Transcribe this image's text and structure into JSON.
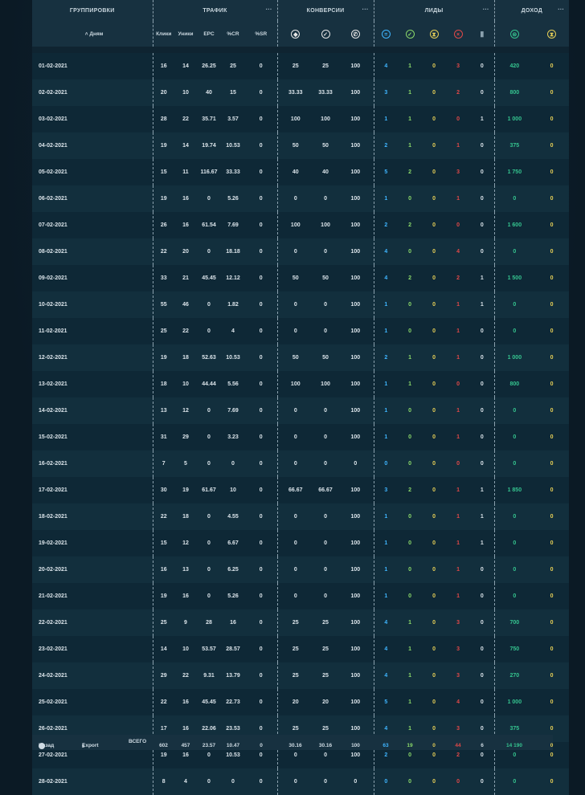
{
  "headers": {
    "grouping": "ГРУППИРОВКИ",
    "traffic": "ТРАФИК",
    "conversions": "КОНВЕРСИИ",
    "leads": "ЛИДЫ",
    "income": "ДОХОД",
    "more": "···",
    "sort_label": "˄ Дням",
    "traffic_cols": [
      "Клики",
      "Уники",
      "EPC",
      "%CR",
      "%SR"
    ]
  },
  "rows": [
    [
      "01-02-2021",
      "16",
      "14",
      "26.25",
      "25",
      "0",
      "25",
      "25",
      "100",
      "4",
      "1",
      "0",
      "3",
      "0",
      "420",
      "0"
    ],
    [
      "02-02-2021",
      "20",
      "10",
      "40",
      "15",
      "0",
      "33.33",
      "33.33",
      "100",
      "3",
      "1",
      "0",
      "2",
      "0",
      "800",
      "0"
    ],
    [
      "03-02-2021",
      "28",
      "22",
      "35.71",
      "3.57",
      "0",
      "100",
      "100",
      "100",
      "1",
      "1",
      "0",
      "0",
      "1",
      "1 000",
      "0"
    ],
    [
      "04-02-2021",
      "19",
      "14",
      "19.74",
      "10.53",
      "0",
      "50",
      "50",
      "100",
      "2",
      "1",
      "0",
      "1",
      "0",
      "375",
      "0"
    ],
    [
      "05-02-2021",
      "15",
      "11",
      "116.67",
      "33.33",
      "0",
      "40",
      "40",
      "100",
      "5",
      "2",
      "0",
      "3",
      "0",
      "1 750",
      "0"
    ],
    [
      "06-02-2021",
      "19",
      "16",
      "0",
      "5.26",
      "0",
      "0",
      "0",
      "100",
      "1",
      "0",
      "0",
      "1",
      "0",
      "0",
      "0"
    ],
    [
      "07-02-2021",
      "26",
      "16",
      "61.54",
      "7.69",
      "0",
      "100",
      "100",
      "100",
      "2",
      "2",
      "0",
      "0",
      "0",
      "1 600",
      "0"
    ],
    [
      "08-02-2021",
      "22",
      "20",
      "0",
      "18.18",
      "0",
      "0",
      "0",
      "100",
      "4",
      "0",
      "0",
      "4",
      "0",
      "0",
      "0"
    ],
    [
      "09-02-2021",
      "33",
      "21",
      "45.45",
      "12.12",
      "0",
      "50",
      "50",
      "100",
      "4",
      "2",
      "0",
      "2",
      "1",
      "1 500",
      "0"
    ],
    [
      "10-02-2021",
      "55",
      "46",
      "0",
      "1.82",
      "0",
      "0",
      "0",
      "100",
      "1",
      "0",
      "0",
      "1",
      "1",
      "0",
      "0"
    ],
    [
      "11-02-2021",
      "25",
      "22",
      "0",
      "4",
      "0",
      "0",
      "0",
      "100",
      "1",
      "0",
      "0",
      "1",
      "0",
      "0",
      "0"
    ],
    [
      "12-02-2021",
      "19",
      "18",
      "52.63",
      "10.53",
      "0",
      "50",
      "50",
      "100",
      "2",
      "1",
      "0",
      "1",
      "0",
      "1 000",
      "0"
    ],
    [
      "13-02-2021",
      "18",
      "10",
      "44.44",
      "5.56",
      "0",
      "100",
      "100",
      "100",
      "1",
      "1",
      "0",
      "0",
      "0",
      "800",
      "0"
    ],
    [
      "14-02-2021",
      "13",
      "12",
      "0",
      "7.69",
      "0",
      "0",
      "0",
      "100",
      "1",
      "0",
      "0",
      "1",
      "0",
      "0",
      "0"
    ],
    [
      "15-02-2021",
      "31",
      "29",
      "0",
      "3.23",
      "0",
      "0",
      "0",
      "100",
      "1",
      "0",
      "0",
      "1",
      "0",
      "0",
      "0"
    ],
    [
      "16-02-2021",
      "7",
      "5",
      "0",
      "0",
      "0",
      "0",
      "0",
      "0",
      "0",
      "0",
      "0",
      "0",
      "0",
      "0",
      "0"
    ],
    [
      "17-02-2021",
      "30",
      "19",
      "61.67",
      "10",
      "0",
      "66.67",
      "66.67",
      "100",
      "3",
      "2",
      "0",
      "1",
      "1",
      "1 850",
      "0"
    ],
    [
      "18-02-2021",
      "22",
      "18",
      "0",
      "4.55",
      "0",
      "0",
      "0",
      "100",
      "1",
      "0",
      "0",
      "1",
      "1",
      "0",
      "0"
    ],
    [
      "19-02-2021",
      "15",
      "12",
      "0",
      "6.67",
      "0",
      "0",
      "0",
      "100",
      "1",
      "0",
      "0",
      "1",
      "1",
      "0",
      "0"
    ],
    [
      "20-02-2021",
      "16",
      "13",
      "0",
      "6.25",
      "0",
      "0",
      "0",
      "100",
      "1",
      "0",
      "0",
      "1",
      "0",
      "0",
      "0"
    ],
    [
      "21-02-2021",
      "19",
      "16",
      "0",
      "5.26",
      "0",
      "0",
      "0",
      "100",
      "1",
      "0",
      "0",
      "1",
      "0",
      "0",
      "0"
    ],
    [
      "22-02-2021",
      "25",
      "9",
      "28",
      "16",
      "0",
      "25",
      "25",
      "100",
      "4",
      "1",
      "0",
      "3",
      "0",
      "700",
      "0"
    ],
    [
      "23-02-2021",
      "14",
      "10",
      "53.57",
      "28.57",
      "0",
      "25",
      "25",
      "100",
      "4",
      "1",
      "0",
      "3",
      "0",
      "750",
      "0"
    ],
    [
      "24-02-2021",
      "29",
      "22",
      "9.31",
      "13.79",
      "0",
      "25",
      "25",
      "100",
      "4",
      "1",
      "0",
      "3",
      "0",
      "270",
      "0"
    ],
    [
      "25-02-2021",
      "22",
      "16",
      "45.45",
      "22.73",
      "0",
      "20",
      "20",
      "100",
      "5",
      "1",
      "0",
      "4",
      "0",
      "1 000",
      "0"
    ],
    [
      "26-02-2021",
      "17",
      "16",
      "22.06",
      "23.53",
      "0",
      "25",
      "25",
      "100",
      "4",
      "1",
      "0",
      "3",
      "0",
      "375",
      "0"
    ],
    [
      "27-02-2021",
      "19",
      "16",
      "0",
      "10.53",
      "0",
      "0",
      "0",
      "100",
      "2",
      "0",
      "0",
      "2",
      "0",
      "0",
      "0"
    ],
    [
      "28-02-2021",
      "8",
      "4",
      "0",
      "0",
      "0",
      "0",
      "0",
      "0",
      "0",
      "0",
      "0",
      "0",
      "0",
      "0",
      "0"
    ]
  ],
  "footer": {
    "back_label": "Назад",
    "export_label": "Export",
    "total_label": "ВСЕГО",
    "totals": [
      "602",
      "457",
      "23.57",
      "10.47",
      "0",
      "30.16",
      "30.16",
      "100",
      "63",
      "19",
      "0",
      "44",
      "6",
      "14 190",
      "0"
    ]
  },
  "colors": {
    "blue": "#3fb5ff",
    "green": "#8bd96a",
    "yellow": "#e6cf57",
    "red": "#e04848",
    "teal": "#35c48f"
  },
  "icons": {
    "conversions": [
      "bag-icon",
      "check-circle-icon",
      "phone-icon"
    ],
    "leads": [
      "equals-circle-icon",
      "check-circle-icon",
      "hourglass-icon",
      "cross-circle-icon",
      "trash-icon"
    ],
    "income": [
      "wallet-icon",
      "hourglass-icon"
    ]
  }
}
